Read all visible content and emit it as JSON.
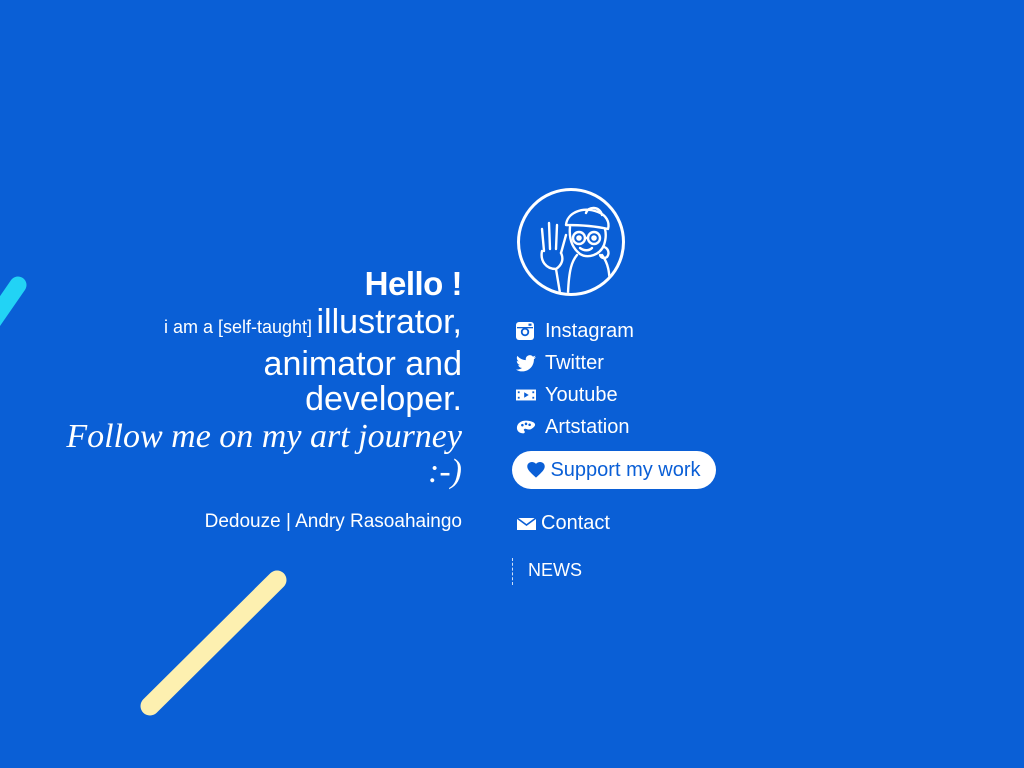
{
  "intro": {
    "hello": "Hello !",
    "prefix": "i am a [self-taught]",
    "role_1": "illustrator,",
    "role_2": "animator and",
    "role_3": "developer.",
    "follow": "Follow me on my art journey :-)",
    "signature": "Dedouze | Andry Rasoahaingo"
  },
  "social": [
    {
      "label": "Instagram",
      "icon": "instagram-icon"
    },
    {
      "label": "Twitter",
      "icon": "twitter-icon"
    },
    {
      "label": "Youtube",
      "icon": "youtube-icon"
    },
    {
      "label": "Artstation",
      "icon": "artstation-icon"
    }
  ],
  "support": {
    "label": "Support my work",
    "icon": "heart-icon"
  },
  "contact": {
    "label": "Contact",
    "icon": "mail-icon"
  },
  "news": {
    "label": "NEWS"
  },
  "colors": {
    "background": "#0a5fd6",
    "text": "#ffffff",
    "accent_cyan": "#22d3f5",
    "accent_yellow": "#fdf0b0"
  }
}
